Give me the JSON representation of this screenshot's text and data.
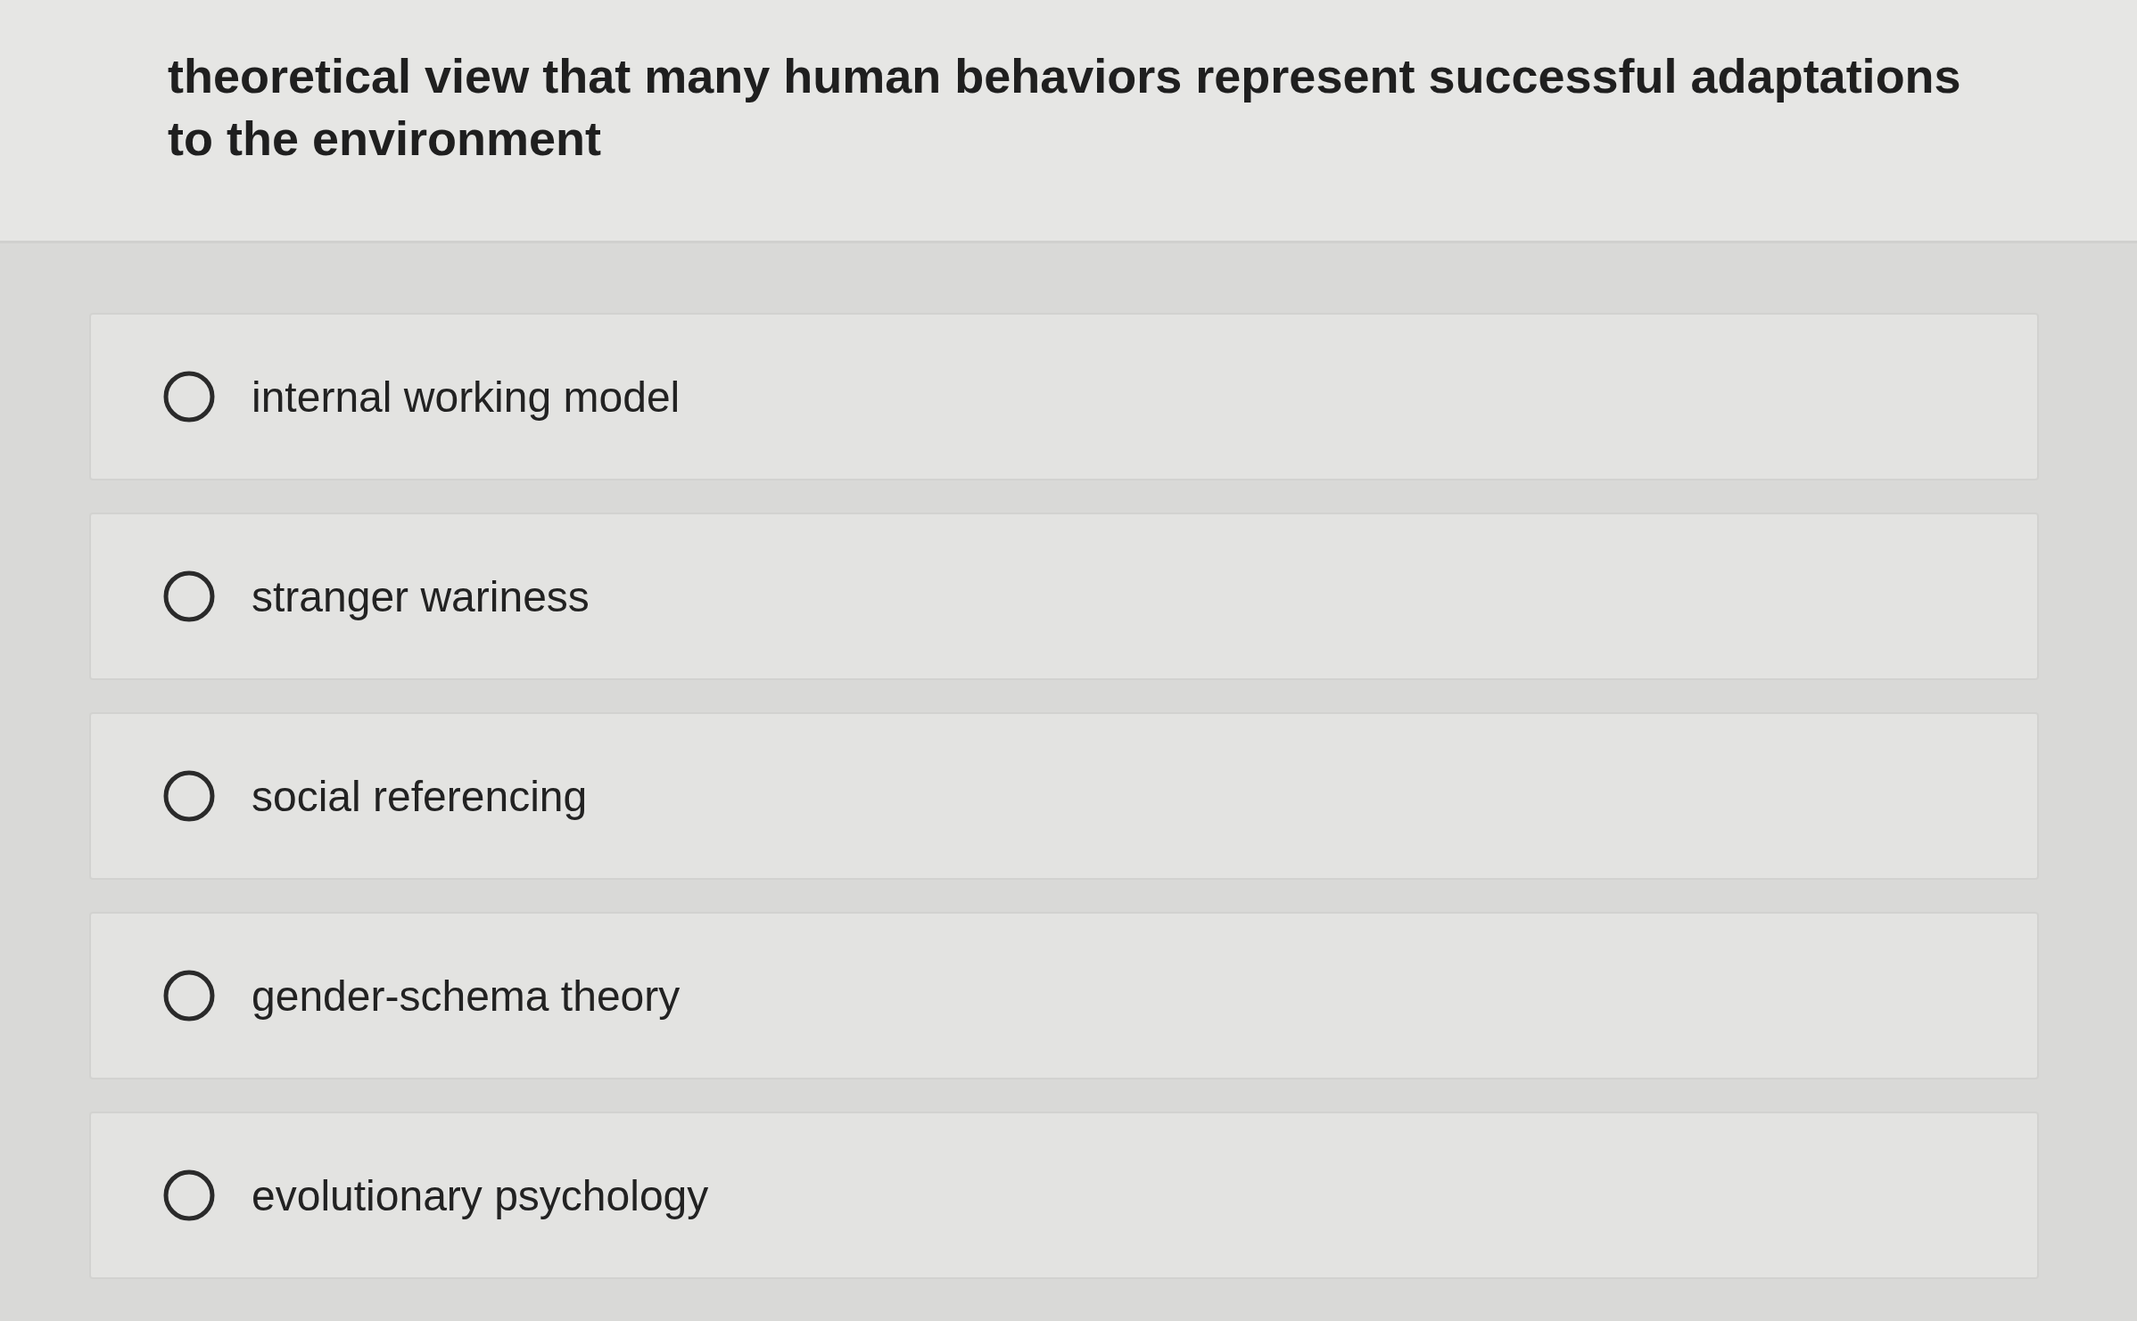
{
  "question": {
    "text": "theoretical view that many human behaviors represent successful adaptations to the environment"
  },
  "options": [
    {
      "label": "internal working model",
      "selected": false
    },
    {
      "label": "stranger wariness",
      "selected": false
    },
    {
      "label": "social referencing",
      "selected": false
    },
    {
      "label": "gender-schema theory",
      "selected": false
    },
    {
      "label": "evolutionary psychology",
      "selected": false
    }
  ]
}
